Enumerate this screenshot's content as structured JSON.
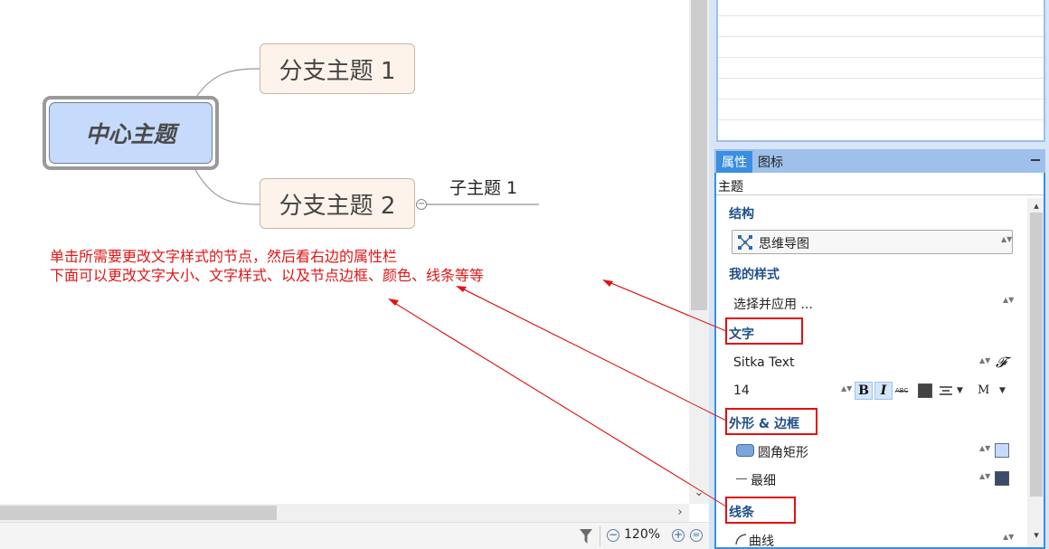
{
  "mindmap": {
    "central_topic": "中心主题",
    "branch_1": "分支主题 1",
    "branch_2": "分支主题 2",
    "subtopic_1": "子主题 1",
    "collapse_symbol": "−"
  },
  "annotation": {
    "line_1": "单击所需要更改文字样式的节点，然后看右边的属性栏",
    "line_2": "下面可以更改文字大小、文字样式、以及节点边框、颜色、线条等等",
    "color": "#e01515"
  },
  "status_bar": {
    "zoom_level": "120%",
    "zoom_out": "−",
    "zoom_in": "+",
    "zoom_fit": "="
  },
  "scroll_arrows": {
    "down": "⌄",
    "right": "›",
    "up": "▴",
    "down_small": "▾"
  },
  "properties_panel": {
    "tab_properties": "属性",
    "tab_icons": "图标",
    "header": "主题",
    "structure_section": "结构",
    "structure_value": "思维导图",
    "my_style_section": "我的样式",
    "my_style_value": "选择并应用 ...",
    "text_section": "文字",
    "font_name": "Sitka Text",
    "font_size": "14",
    "bold_label": "B",
    "italic_label": "I",
    "strike_label": "ABC",
    "spacing_label": "M",
    "shape_section": "外形 & 边框",
    "shape_value": "圆角矩形",
    "border_value": "最细",
    "line_section": "线条",
    "line_value": "曲线",
    "spinner_glyph": "▲▼",
    "font_icon_glyph": "𝓕",
    "dropdown_glyph": "▼",
    "shape_fill_color": "#c6dafb",
    "border_color": "#3d4b6b",
    "text_color": "#444444"
  },
  "colors": {
    "accent": "#3b8ee0",
    "panel_bg": "#d7e5f6",
    "section_title": "#1f4f8a",
    "highlight_red": "#e31010"
  }
}
